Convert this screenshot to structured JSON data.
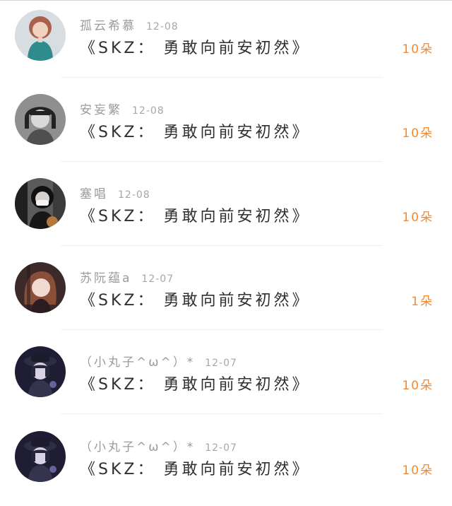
{
  "items": [
    {
      "name": "孤云希慕",
      "date": "12-08",
      "title": "《SKZ： 勇敢向前安初然》",
      "amount": "10朵",
      "avatar_icon": "avatar-woman-teal-top"
    },
    {
      "name": "安妄繁",
      "date": "12-08",
      "title": "《SKZ： 勇敢向前安初然》",
      "amount": "10朵",
      "avatar_icon": "avatar-short-hair-grayscale"
    },
    {
      "name": "塞唱",
      "date": "12-08",
      "title": "《SKZ： 勇敢向前安初然》",
      "amount": "10朵",
      "avatar_icon": "avatar-mask-dark-photo"
    },
    {
      "name": "苏阮蕴a",
      "date": "12-07",
      "title": "《SKZ： 勇敢向前安初然》",
      "amount": "1朵",
      "avatar_icon": "avatar-woman-reddish-hair"
    },
    {
      "name": "（小丸子^ω^）*",
      "date": "12-07",
      "title": "《SKZ： 勇敢向前安初然》",
      "amount": "10朵",
      "avatar_icon": "avatar-dark-anime-hat"
    },
    {
      "name": "（小丸子^ω^）*",
      "date": "12-07",
      "title": "《SKZ： 勇敢向前安初然》",
      "amount": "10朵",
      "avatar_icon": "avatar-dark-anime-hat"
    }
  ]
}
